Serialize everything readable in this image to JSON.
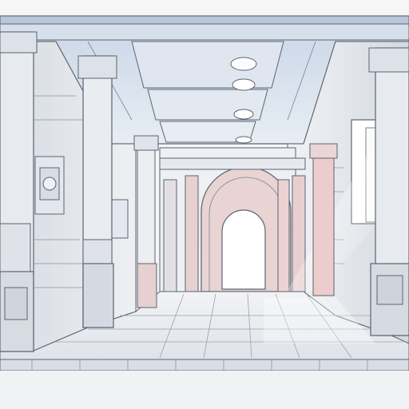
{
  "scene": {
    "kind": "illustration",
    "palette": {
      "line": "#5b6470",
      "stone_light": "#eef0f3",
      "stone_mid": "#d9dde3",
      "stone_shadow": "#c5ccd6",
      "sky_tint": "#c9d8ea",
      "warm_glow": "#e7a3a3",
      "doorway_light": "#ffffff",
      "floor": "#e9ebef"
    },
    "icons": [
      "arched-doorway-icon",
      "ceiling-light-icon",
      "carved-panel-icon"
    ],
    "ceiling_lights_count": 4
  }
}
